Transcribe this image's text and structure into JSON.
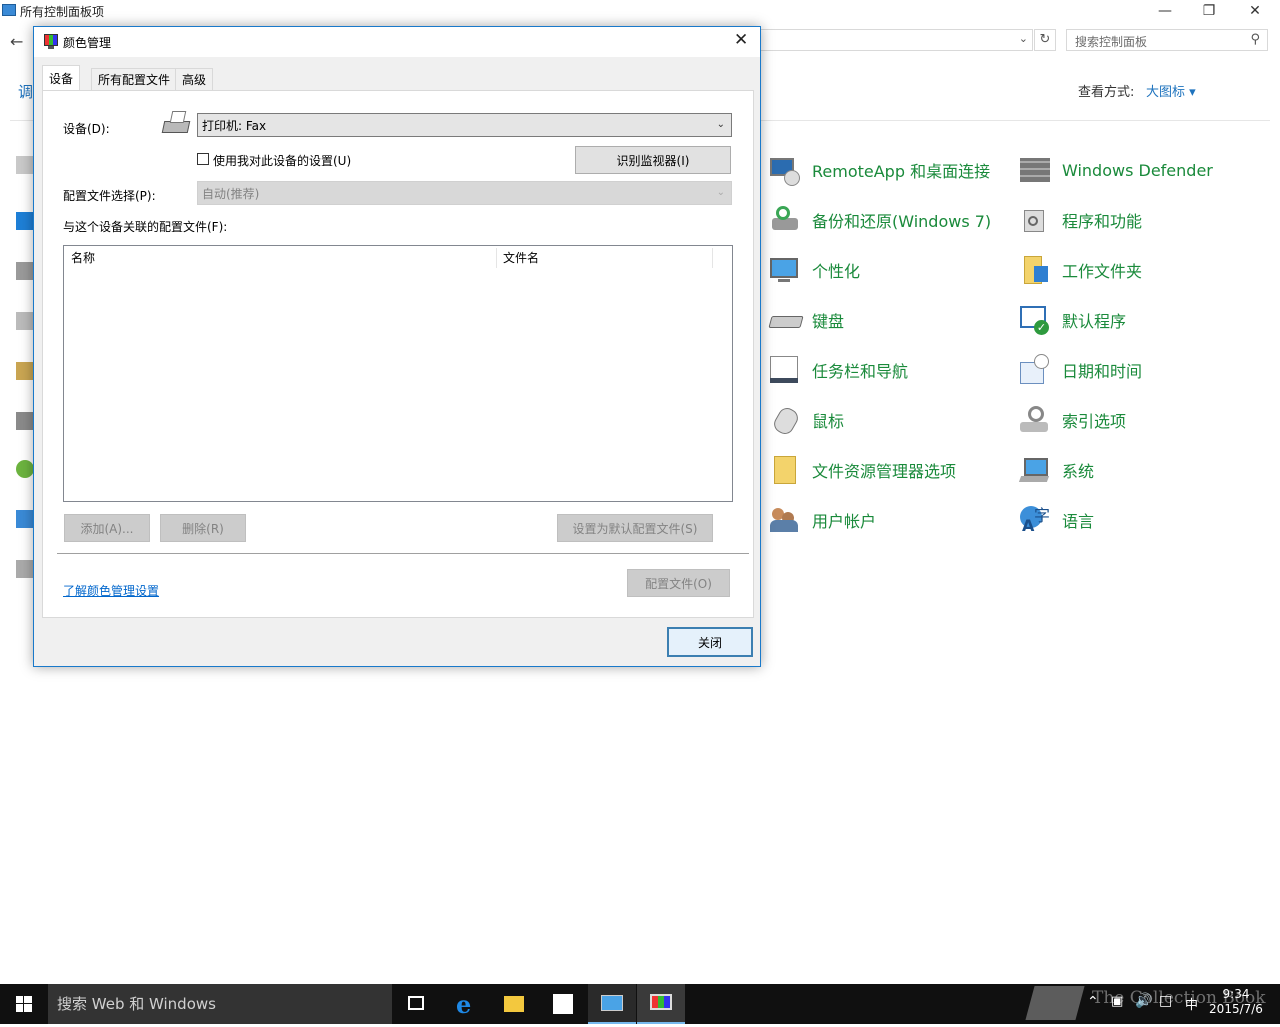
{
  "control_panel": {
    "window_title": "所有控制面板项",
    "left_heading_partial": "调",
    "search_placeholder": "搜索控制面板",
    "view_by_label": "查看方式:",
    "view_by_value": "大图标 ▾",
    "items_col1": [
      {
        "label": "RemoteApp 和桌面连接",
        "icon": "remoteapp-icon"
      },
      {
        "label": "备份和还原(Windows 7)",
        "icon": "backup-icon"
      },
      {
        "label": "个性化",
        "icon": "personalization-icon"
      },
      {
        "label": "键盘",
        "icon": "keyboard-icon"
      },
      {
        "label": "任务栏和导航",
        "icon": "taskbar-icon"
      },
      {
        "label": "鼠标",
        "icon": "mouse-icon"
      },
      {
        "label": "文件资源管理器选项",
        "icon": "folder-options-icon"
      },
      {
        "label": "用户帐户",
        "icon": "user-accounts-icon"
      }
    ],
    "items_col2": [
      {
        "label": "Windows Defender",
        "icon": "defender-icon"
      },
      {
        "label": "程序和功能",
        "icon": "programs-icon"
      },
      {
        "label": "工作文件夹",
        "icon": "work-folders-icon"
      },
      {
        "label": "默认程序",
        "icon": "default-programs-icon"
      },
      {
        "label": "日期和时间",
        "icon": "date-time-icon"
      },
      {
        "label": "索引选项",
        "icon": "indexing-icon"
      },
      {
        "label": "系统",
        "icon": "system-icon"
      },
      {
        "label": "语言",
        "icon": "language-icon"
      }
    ]
  },
  "dialog": {
    "title": "颜色管理",
    "close_glyph": "✕",
    "tabs": [
      "设备",
      "所有配置文件",
      "高级"
    ],
    "device_label": "设备(D):",
    "device_value": "打印机: Fax",
    "use_settings_label": "使用我对此设备的设置(U)",
    "identify_monitors": "识别监视器(I)",
    "profile_select_label": "配置文件选择(P):",
    "profile_select_value": "自动(推荐)",
    "associated_label": "与这个设备关联的配置文件(F):",
    "columns": [
      "名称",
      "文件名"
    ],
    "add_button": "添加(A)...",
    "remove_button": "删除(R)",
    "set_default_button": "设置为默认配置文件(S)",
    "learn_link": "了解颜色管理设置",
    "profiles_button": "配置文件(O)",
    "close_button": "关闭"
  },
  "taskbar": {
    "search_text": "搜索 Web 和 Windows",
    "time": "9:34",
    "date": "2015/7/6",
    "ime": "中",
    "watermark": "The Collection Book"
  },
  "colors": {
    "accent": "#1979ca",
    "item_text": "#1a8a3b",
    "taskbar": "#101010"
  }
}
